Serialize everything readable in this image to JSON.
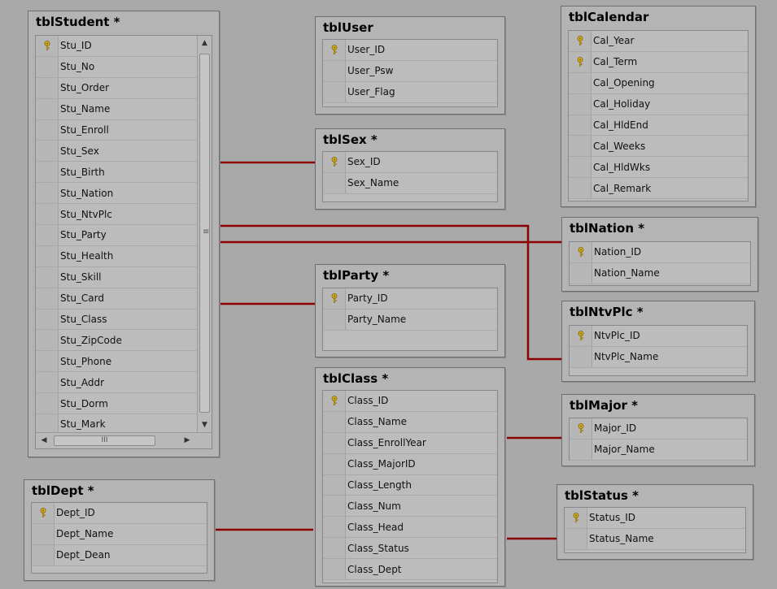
{
  "colors": {
    "background": "#a9a9a9",
    "relationship": "#8b0000",
    "table_bg": "#b4b4b4"
  },
  "tables": {
    "student": {
      "title": "tblStudent *",
      "rows": [
        {
          "name": "Stu_ID",
          "key": true
        },
        {
          "name": "Stu_No",
          "key": false
        },
        {
          "name": "Stu_Order",
          "key": false
        },
        {
          "name": "Stu_Name",
          "key": false
        },
        {
          "name": "Stu_Enroll",
          "key": false
        },
        {
          "name": "Stu_Sex",
          "key": false
        },
        {
          "name": "Stu_Birth",
          "key": false
        },
        {
          "name": "Stu_Nation",
          "key": false
        },
        {
          "name": "Stu_NtvPlc",
          "key": false
        },
        {
          "name": "Stu_Party",
          "key": false
        },
        {
          "name": "Stu_Health",
          "key": false
        },
        {
          "name": "Stu_Skill",
          "key": false
        },
        {
          "name": "Stu_Card",
          "key": false
        },
        {
          "name": "Stu_Class",
          "key": false
        },
        {
          "name": "Stu_ZipCode",
          "key": false
        },
        {
          "name": "Stu_Phone",
          "key": false
        },
        {
          "name": "Stu_Addr",
          "key": false
        },
        {
          "name": "Stu_Dorm",
          "key": false
        },
        {
          "name": "Stu_Mark",
          "key": false
        }
      ],
      "scroll": {
        "up": "▲",
        "down": "▼",
        "left": "◀",
        "right": "▶",
        "grip_v": "≡",
        "grip_h": "III"
      }
    },
    "user": {
      "title": "tblUser",
      "rows": [
        {
          "name": "User_ID",
          "key": true
        },
        {
          "name": "User_Psw",
          "key": false
        },
        {
          "name": "User_Flag",
          "key": false
        }
      ]
    },
    "sex": {
      "title": "tblSex *",
      "rows": [
        {
          "name": "Sex_ID",
          "key": true
        },
        {
          "name": "Sex_Name",
          "key": false
        }
      ]
    },
    "calendar": {
      "title": "tblCalendar",
      "rows": [
        {
          "name": "Cal_Year",
          "key": true
        },
        {
          "name": "Cal_Term",
          "key": true
        },
        {
          "name": "Cal_Opening",
          "key": false
        },
        {
          "name": "Cal_Holiday",
          "key": false
        },
        {
          "name": "Cal_HldEnd",
          "key": false
        },
        {
          "name": "Cal_Weeks",
          "key": false
        },
        {
          "name": "Cal_HldWks",
          "key": false
        },
        {
          "name": "Cal_Remark",
          "key": false
        }
      ]
    },
    "nation": {
      "title": "tblNation *",
      "rows": [
        {
          "name": "Nation_ID",
          "key": true
        },
        {
          "name": "Nation_Name",
          "key": false
        }
      ]
    },
    "party": {
      "title": "tblParty *",
      "rows": [
        {
          "name": "Party_ID",
          "key": true
        },
        {
          "name": "Party_Name",
          "key": false
        }
      ]
    },
    "ntvplc": {
      "title": "tblNtvPlc *",
      "rows": [
        {
          "name": "NtvPlc_ID",
          "key": true
        },
        {
          "name": "NtvPlc_Name",
          "key": false
        }
      ]
    },
    "class": {
      "title": "tblClass *",
      "rows": [
        {
          "name": "Class_ID",
          "key": true
        },
        {
          "name": "Class_Name",
          "key": false
        },
        {
          "name": "Class_EnrollYear",
          "key": false
        },
        {
          "name": "Class_MajorID",
          "key": false
        },
        {
          "name": "Class_Length",
          "key": false
        },
        {
          "name": "Class_Num",
          "key": false
        },
        {
          "name": "Class_Head",
          "key": false
        },
        {
          "name": "Class_Status",
          "key": false
        },
        {
          "name": "Class_Dept",
          "key": false
        }
      ]
    },
    "major": {
      "title": "tblMajor *",
      "rows": [
        {
          "name": "Major_ID",
          "key": true
        },
        {
          "name": "Major_Name",
          "key": false
        }
      ]
    },
    "dept": {
      "title": "tblDept *",
      "rows": [
        {
          "name": "Dept_ID",
          "key": true
        },
        {
          "name": "Dept_Name",
          "key": false
        },
        {
          "name": "Dept_Dean",
          "key": false
        }
      ]
    },
    "status": {
      "title": "tblStatus *",
      "rows": [
        {
          "name": "Status_ID",
          "key": true
        },
        {
          "name": "Status_Name",
          "key": false
        }
      ]
    }
  }
}
